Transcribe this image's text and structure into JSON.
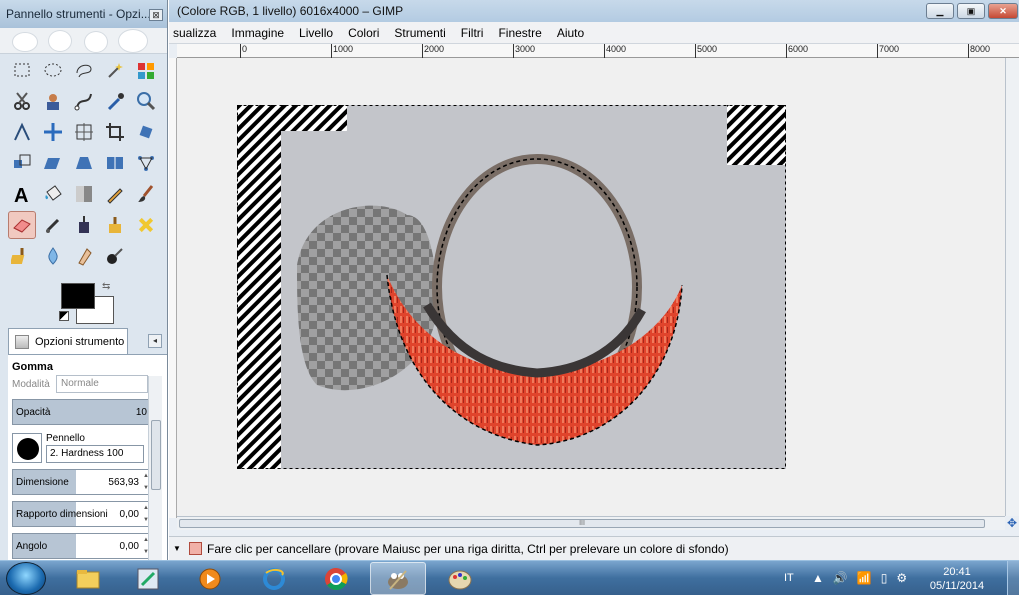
{
  "toolbox": {
    "title": "Pannello strumenti - Opzi...",
    "close_glyph": "⊠",
    "tools": [
      "rect-select",
      "ellipse-select",
      "free-select",
      "fuzzy-select",
      "color-select",
      "scissors",
      "foreground-select",
      "paths",
      "color-picker",
      "zoom",
      "measure",
      "move",
      "align",
      "crop",
      "rotate",
      "scale",
      "shear",
      "perspective",
      "flip",
      "cage-transform",
      "text",
      "bucket-fill",
      "blend",
      "pencil",
      "paintbrush",
      "eraser",
      "airbrush",
      "ink",
      "clone",
      "heal",
      "perspective-clone",
      "blur",
      "smudge",
      "dodge-burn"
    ],
    "selected_tool": "eraser",
    "swap_glyph": "⇆",
    "options_tab": {
      "label": "Opzioni strumento",
      "menu_glyph": "◂"
    },
    "options": {
      "tool_name": "Gomma",
      "mode_label": "Modalità",
      "mode_value": "Normale",
      "opacity_label": "Opacità",
      "opacity_value": "10",
      "brush_label": "Pennello",
      "brush_value": "2. Hardness 100",
      "size_label": "Dimensione",
      "size_value": "563,93",
      "ratio_label": "Rapporto dimensioni",
      "ratio_value": "0,00",
      "angle_label": "Angolo",
      "angle_value": "0,00"
    }
  },
  "window": {
    "title": "(Colore RGB, 1 livello) 6016x4000 – GIMP",
    "buttons": {
      "minimize": "▁",
      "maximize": "▣",
      "close": "✕"
    }
  },
  "menu": [
    "sualizza",
    "Immagine",
    "Livello",
    "Colori",
    "Strumenti",
    "Filtri",
    "Finestre",
    "Aiuto"
  ],
  "ruler_labels": [
    "0",
    "1000",
    "2000",
    "3000",
    "4000",
    "5000",
    "6000",
    "7000",
    "8000"
  ],
  "scroll_grip": "III",
  "status": {
    "arrow": "▼",
    "message": "Fare clic per cancellare (provare Maiusc per una riga diritta, Ctrl per prelevare un colore di sfondo)"
  },
  "taskbar": {
    "lang": "IT",
    "time": "20:41",
    "date": "05/11/2014",
    "apps": [
      "explorer",
      "paint-tool",
      "media-player",
      "internet-explorer",
      "chrome",
      "gimp",
      "paint"
    ],
    "active_app": "gimp"
  },
  "colors": {
    "accent_red": "#e0442c",
    "canvas_gray": "#c3c5ca"
  }
}
